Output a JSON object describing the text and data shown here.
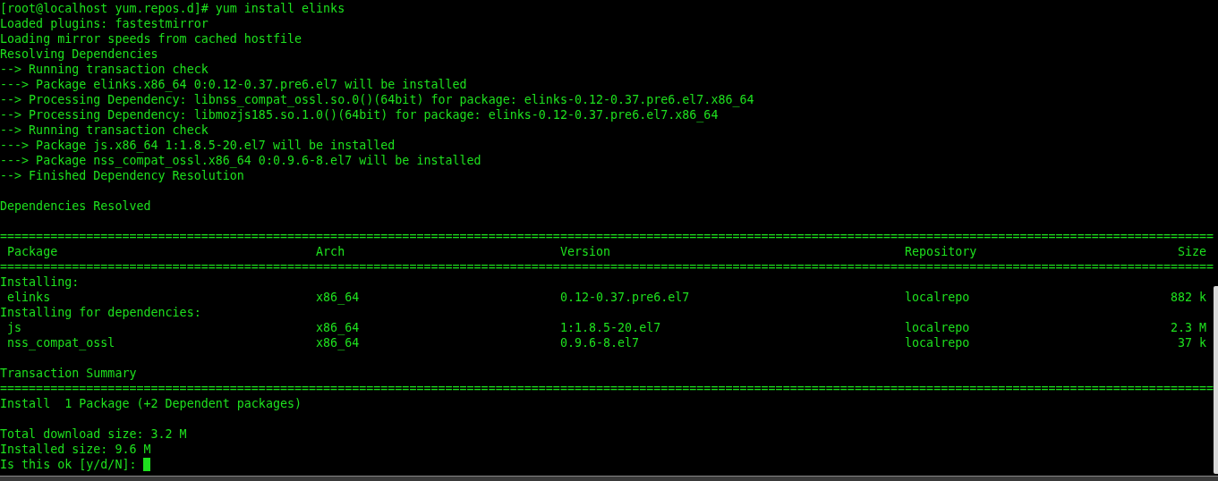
{
  "terminal": {
    "lines": [
      {
        "kind": "text",
        "text": "[root@localhost yum.repos.d]# yum install elinks"
      },
      {
        "kind": "text",
        "text": "Loaded plugins: fastestmirror"
      },
      {
        "kind": "text",
        "text": "Loading mirror speeds from cached hostfile"
      },
      {
        "kind": "text",
        "text": "Resolving Dependencies"
      },
      {
        "kind": "text",
        "text": "--> Running transaction check"
      },
      {
        "kind": "text",
        "text": "---> Package elinks.x86_64 0:0.12-0.37.pre6.el7 will be installed"
      },
      {
        "kind": "text",
        "text": "--> Processing Dependency: libnss_compat_ossl.so.0()(64bit) for package: elinks-0.12-0.37.pre6.el7.x86_64"
      },
      {
        "kind": "text",
        "text": "--> Processing Dependency: libmozjs185.so.1.0()(64bit) for package: elinks-0.12-0.37.pre6.el7.x86_64"
      },
      {
        "kind": "text",
        "text": "--> Running transaction check"
      },
      {
        "kind": "text",
        "text": "---> Package js.x86_64 1:1.8.5-20.el7 will be installed"
      },
      {
        "kind": "text",
        "text": "---> Package nss_compat_ossl.x86_64 0:0.9.6-8.el7 will be installed"
      },
      {
        "kind": "text",
        "text": "--> Finished Dependency Resolution"
      },
      {
        "kind": "blank"
      },
      {
        "kind": "text",
        "text": "Dependencies Resolved"
      },
      {
        "kind": "blank"
      },
      {
        "kind": "rule",
        "text": "========================================================================================================================================================================="
      },
      {
        "kind": "header",
        "cells": [
          "Package",
          "Arch",
          "Version",
          "Repository",
          "Size"
        ]
      },
      {
        "kind": "rule",
        "text": "========================================================================================================================================================================="
      },
      {
        "kind": "text",
        "text": "Installing:"
      },
      {
        "kind": "row",
        "cells": [
          "elinks",
          "x86_64",
          "0.12-0.37.pre6.el7",
          "localrepo",
          "882 k"
        ]
      },
      {
        "kind": "text",
        "text": "Installing for dependencies:"
      },
      {
        "kind": "row",
        "cells": [
          "js",
          "x86_64",
          "1:1.8.5-20.el7",
          "localrepo",
          "2.3 M"
        ]
      },
      {
        "kind": "row",
        "cells": [
          "nss_compat_ossl",
          "x86_64",
          "0.9.6-8.el7",
          "localrepo",
          "37 k"
        ]
      },
      {
        "kind": "blank"
      },
      {
        "kind": "text",
        "text": "Transaction Summary"
      },
      {
        "kind": "rule",
        "text": "========================================================================================================================================================================="
      },
      {
        "kind": "text",
        "text": "Install  1 Package (+2 Dependent packages)"
      },
      {
        "kind": "blank"
      },
      {
        "kind": "text",
        "text": "Total download size: 3.2 M"
      },
      {
        "kind": "text",
        "text": "Installed size: 9.6 M"
      },
      {
        "kind": "prompt",
        "text": "Is this ok [y/d/N]: "
      }
    ]
  }
}
